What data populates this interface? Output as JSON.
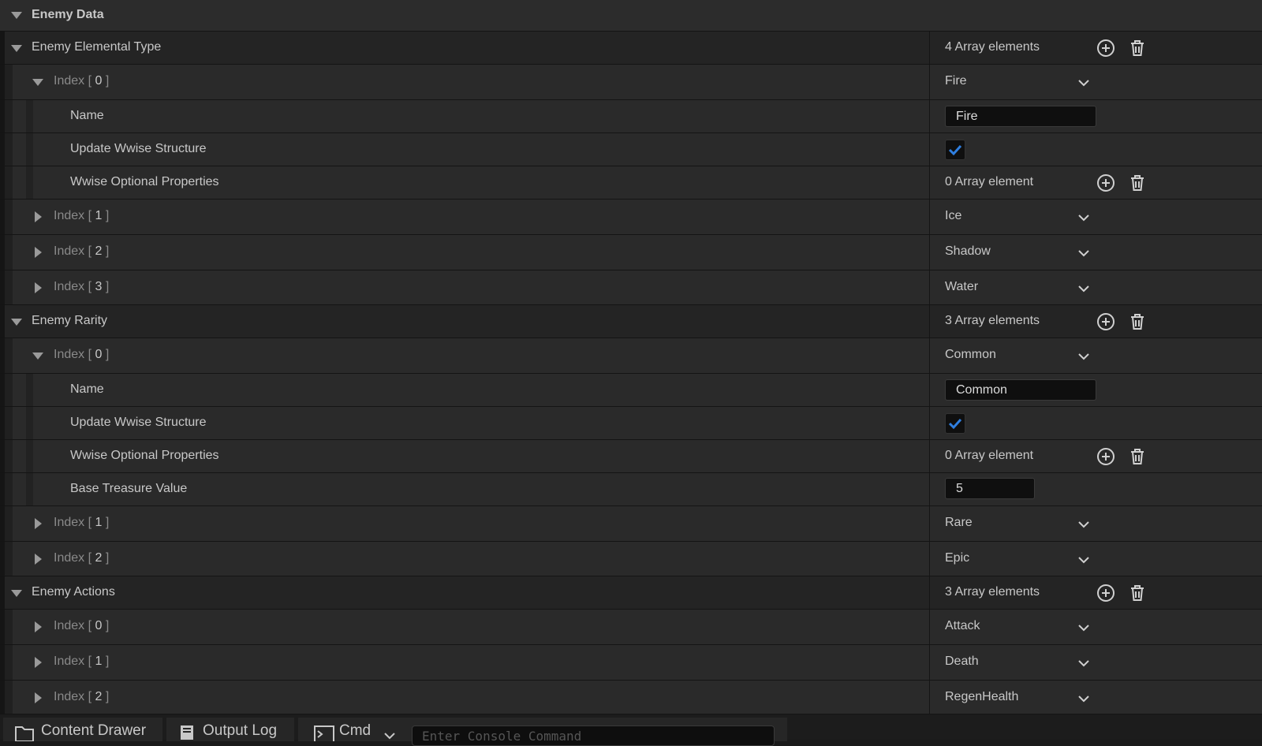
{
  "panel": {
    "title": "Enemy Data",
    "sections": [
      {
        "label": "Enemy Elemental Type",
        "count": "4 Array elements",
        "items": [
          {
            "index": "0",
            "value": "Fire",
            "expanded": true,
            "fields": {
              "name_label": "Name",
              "name_value": "Fire",
              "update_label": "Update Wwise Structure",
              "optional_label": "Wwise Optional Properties",
              "optional_count": "0 Array element"
            }
          },
          {
            "index": "1",
            "value": "Ice"
          },
          {
            "index": "2",
            "value": "Shadow"
          },
          {
            "index": "3",
            "value": "Water"
          }
        ]
      },
      {
        "label": "Enemy Rarity",
        "count": "3 Array elements",
        "items": [
          {
            "index": "0",
            "value": "Common",
            "expanded": true,
            "fields": {
              "name_label": "Name",
              "name_value": "Common",
              "update_label": "Update Wwise Structure",
              "optional_label": "Wwise Optional Properties",
              "optional_count": "0 Array element",
              "treasure_label": "Base Treasure Value",
              "treasure_value": "5"
            }
          },
          {
            "index": "1",
            "value": "Rare"
          },
          {
            "index": "2",
            "value": "Epic"
          }
        ]
      },
      {
        "label": "Enemy Actions",
        "count": "3 Array elements",
        "items": [
          {
            "index": "0",
            "value": "Attack"
          },
          {
            "index": "1",
            "value": "Death"
          },
          {
            "index": "2",
            "value": "RegenHealth"
          }
        ]
      }
    ],
    "index_prefix": "Index [ ",
    "index_suffix": " ]"
  },
  "bottom_bar": {
    "content_drawer": "Content Drawer",
    "output_log": "Output Log",
    "cmd": "Cmd",
    "console_placeholder": "Enter Console Command"
  },
  "colors": {
    "checkbox_check": "#2f7fe0",
    "icon": "#d0d0d0"
  }
}
